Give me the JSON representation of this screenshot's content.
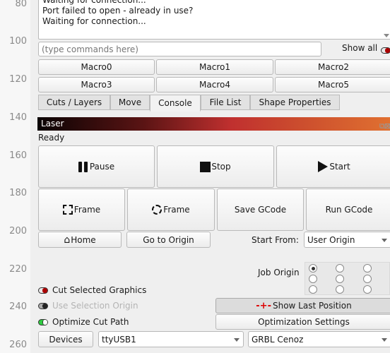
{
  "gutter": {
    "line_numbers": [
      "80",
      "100",
      "120",
      "140",
      "160",
      "180",
      "200",
      "220",
      "240",
      "260"
    ]
  },
  "console": {
    "output_lines": [
      "Waiting for connection...",
      "Port failed to open - already in use?",
      "Waiting for connection..."
    ],
    "input_placeholder": "(type commands here)",
    "input_value": "",
    "show_all_label": "Show all",
    "show_all_state": "off"
  },
  "macros": [
    "Macro0",
    "Macro1",
    "Macro2",
    "Macro3",
    "Macro4",
    "Macro5"
  ],
  "tabs": [
    {
      "label": "Cuts / Layers",
      "active": false
    },
    {
      "label": "Move",
      "active": false
    },
    {
      "label": "Console",
      "active": true
    },
    {
      "label": "File List",
      "active": false
    },
    {
      "label": "Shape Properties",
      "active": false
    }
  ],
  "laser_panel": {
    "title": "Laser",
    "status": "Ready",
    "buttons": {
      "pause": "Pause",
      "stop": "Stop",
      "start": "Start",
      "frame_rect": "Frame",
      "frame_circle": "Frame",
      "save_gcode": "Save GCode",
      "run_gcode": "Run GCode",
      "home": "Home",
      "go_to_origin": "Go to Origin",
      "show_last_position": "Show Last Position",
      "optimization_settings": "Optimization Settings",
      "devices": "Devices"
    },
    "start_from_label": "Start From:",
    "start_from_value": "User Origin",
    "job_origin_label": "Job Origin",
    "job_origin_selected": "top-left",
    "options": [
      {
        "label": "Cut Selected Graphics",
        "state": "off",
        "enabled": true
      },
      {
        "label": "Use Selection Origin",
        "state": "off",
        "enabled": false
      },
      {
        "label": "Optimize Cut Path",
        "state": "on",
        "enabled": true
      }
    ],
    "port_value": "ttyUSB1",
    "device_value": "GRBL Cenoz"
  },
  "colors": {
    "toggle_off": "#aa0000",
    "toggle_on": "#2ecc40",
    "laser_gradient_start": "#0a0303",
    "laser_gradient_end": "#e07030"
  }
}
